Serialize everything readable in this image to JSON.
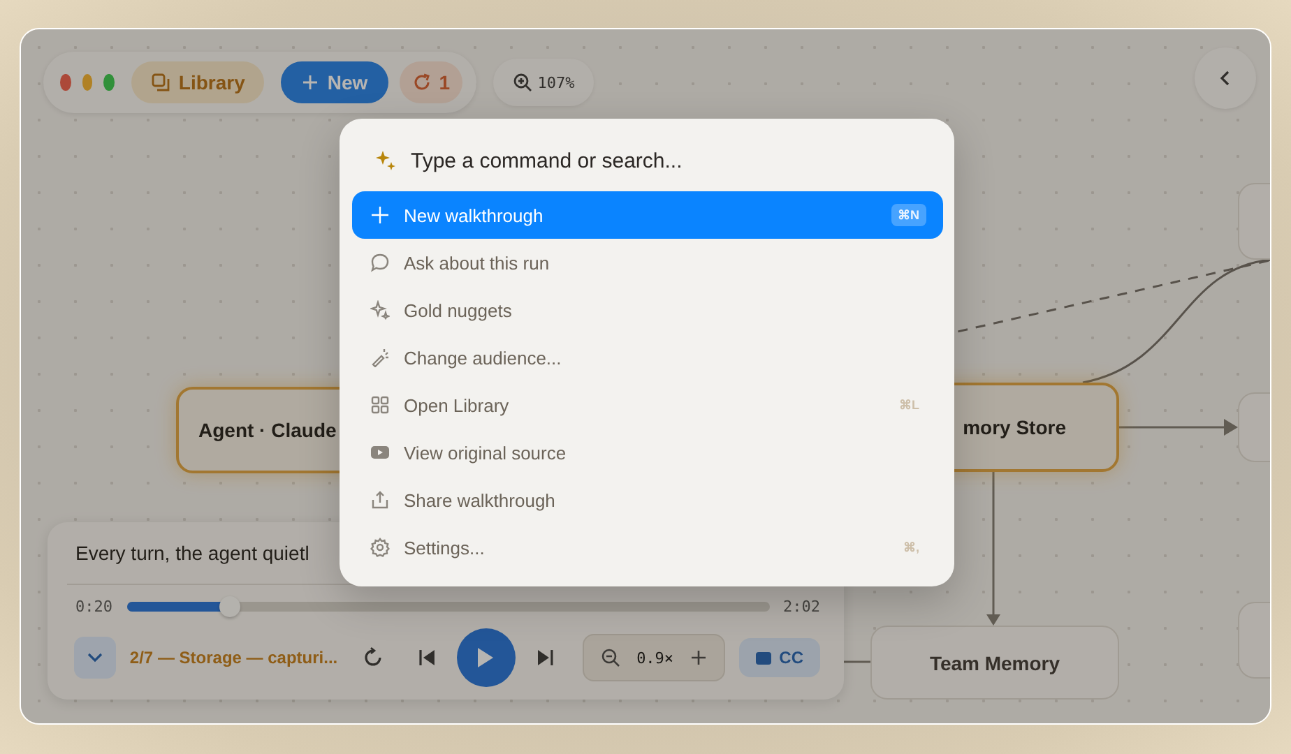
{
  "toolbar": {
    "library_button": "Library",
    "new_button": "New",
    "sync_count": "1",
    "zoom": "107%"
  },
  "canvas": {
    "nodes": [
      {
        "label": "Agent · Claude",
        "selected": true
      },
      {
        "label": "mory Store",
        "selected": true
      },
      {
        "label": "Team Memory",
        "selected": false
      }
    ]
  },
  "player": {
    "caption": "Every turn, the agent quietl",
    "time_elapsed": "0:20",
    "time_total": "2:02",
    "level": 0.16,
    "chapter": "2/7 — Storage — capturi...",
    "speed": "0.9×",
    "captions_button": "CC",
    "captions_on": true
  },
  "command_palette": {
    "placeholder": "Type a command or search...",
    "items": [
      {
        "label": "New walkthrough",
        "shortcut": "⌘N",
        "selected": true
      },
      {
        "label": "Ask about this run",
        "selected": false
      },
      {
        "label": "Gold nuggets",
        "selected": false
      },
      {
        "label": "Change audience...",
        "selected": false
      },
      {
        "label": "Open Library",
        "shortcut": "⌘L",
        "selected": false
      },
      {
        "label": "View original source",
        "selected": false
      },
      {
        "label": "Share walkthrough",
        "selected": false
      },
      {
        "label": "Settings...",
        "shortcut": "⌘,",
        "selected": false
      }
    ]
  }
}
